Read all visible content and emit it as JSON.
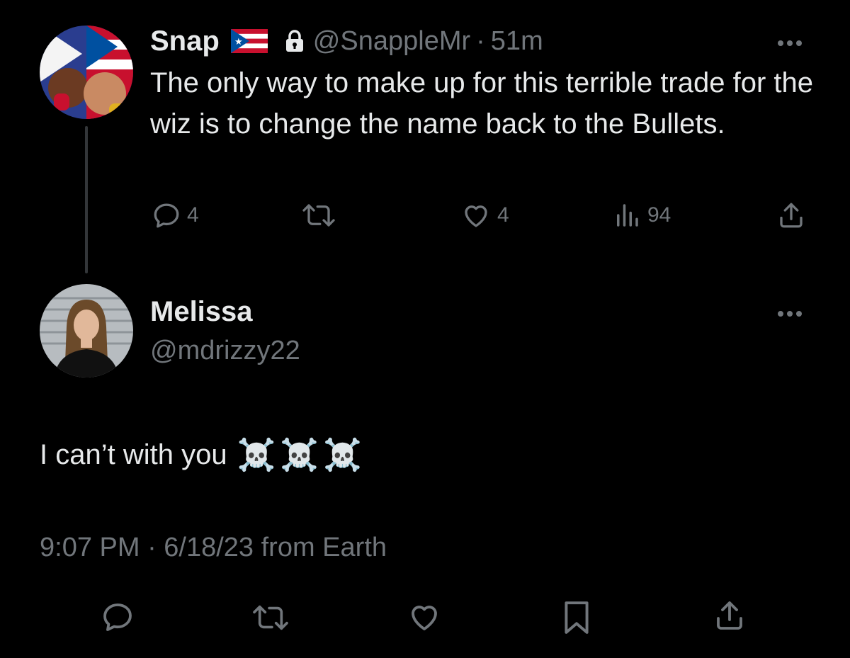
{
  "parent_tweet": {
    "display_name": "Snap",
    "handle": "@SnappleMr",
    "separator": "·",
    "time_ago": "51m",
    "text": "The only way to make up for this terrible trade for the wiz is to change the name back to the Bullets.",
    "actions": {
      "reply_count": "4",
      "retweet_count": "",
      "like_count": "4",
      "views_count": "94"
    },
    "icons": [
      "puerto-rico-flag-icon",
      "lock-icon",
      "more-icon",
      "reply-icon",
      "retweet-icon",
      "like-icon",
      "views-icon",
      "share-icon"
    ]
  },
  "reply_tweet": {
    "display_name": "Melissa",
    "handle": "@mdrizzy22",
    "text": "I can’t with you",
    "emoji": "☠️☠️☠️",
    "timestamp": "9:07 PM · 6/18/23 from Earth",
    "icons": [
      "more-icon",
      "reply-icon",
      "retweet-icon",
      "like-icon",
      "bookmark-icon",
      "share-icon"
    ]
  },
  "colors": {
    "background": "#000000",
    "text": "#e7e9ea",
    "secondary": "#71767b",
    "thread_line": "#333639"
  }
}
